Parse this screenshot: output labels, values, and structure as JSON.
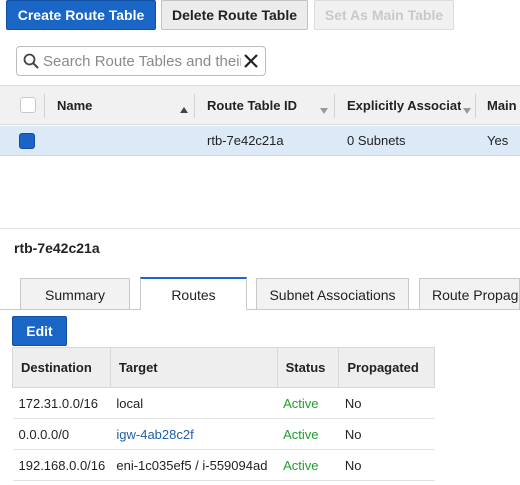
{
  "toolbar": {
    "create_label": "Create Route Table",
    "delete_label": "Delete Route Table",
    "set_main_label": "Set As Main Table"
  },
  "search": {
    "placeholder": "Search Route Tables and their"
  },
  "grid": {
    "columns": [
      "Name",
      "Route Table ID",
      "Explicitly Associat",
      "Main"
    ],
    "rows": [
      {
        "name": "",
        "route_table_id": "rtb-7e42c21a",
        "explicitly_associated": "0 Subnets",
        "main": "Yes"
      }
    ]
  },
  "detail": {
    "title": "rtb-7e42c21a",
    "tabs": [
      "Summary",
      "Routes",
      "Subnet Associations",
      "Route Propaga"
    ],
    "active_tab": "Routes",
    "edit_label": "Edit",
    "routes_columns": [
      "Destination",
      "Target",
      "Status",
      "Propagated"
    ],
    "routes": [
      {
        "destination": "172.31.0.0/16",
        "target": "local",
        "status": "Active",
        "propagated": "No"
      },
      {
        "destination": "0.0.0.0/0",
        "target": "igw-4ab28c2f",
        "status": "Active",
        "propagated": "No"
      },
      {
        "destination": "192.168.0.0/16",
        "target": "eni-1c035ef5 / i-559094ad",
        "status": "Active",
        "propagated": "No"
      }
    ]
  },
  "colors": {
    "primary": "#1a66c6",
    "selected_row": "#dce9f7",
    "active_status": "#1e9e2a",
    "link": "#1f5ea8"
  },
  "icons": [
    "search-icon",
    "clear-icon",
    "sort-asc-icon",
    "sort-desc-icon",
    "column-menu-icon"
  ]
}
